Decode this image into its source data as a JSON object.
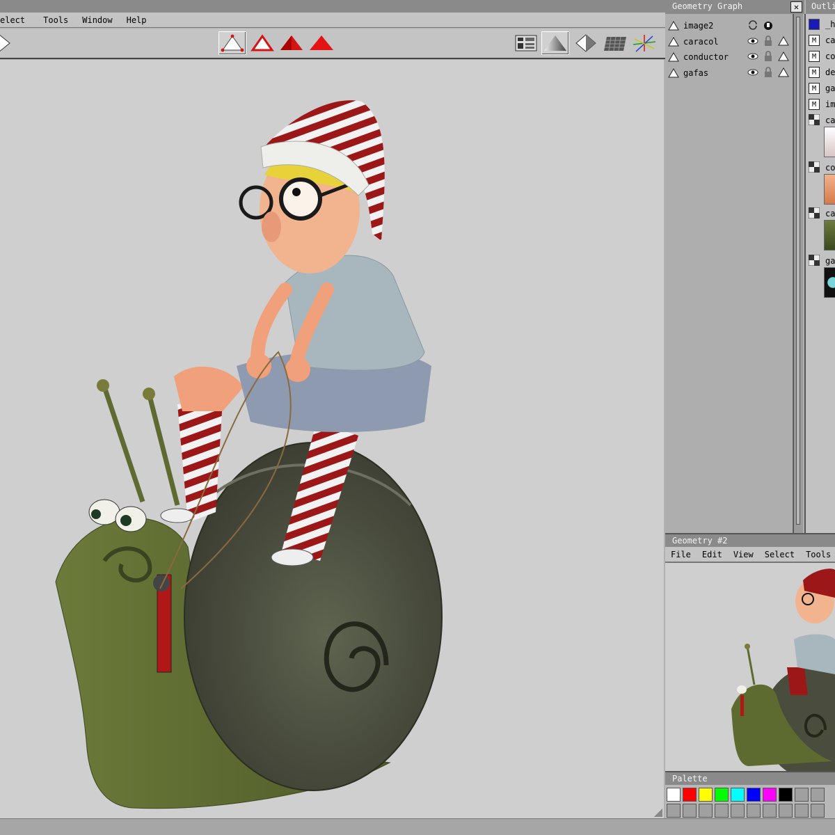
{
  "menu": {
    "items": [
      "elect",
      "Tools",
      "Window",
      "Help"
    ]
  },
  "geometry_graph": {
    "title": "Geometry Graph",
    "items": [
      {
        "label": "image2",
        "icons": [
          "loop-icon",
          "lock-icon"
        ]
      },
      {
        "label": "caracol",
        "icons": [
          "eye-icon",
          "lock-icon",
          "triangle-icon"
        ]
      },
      {
        "label": "conductor",
        "icons": [
          "eye-icon",
          "lock-icon",
          "triangle-icon"
        ]
      },
      {
        "label": "gafas",
        "icons": [
          "eye-icon",
          "lock-icon",
          "triangle-icon"
        ]
      }
    ]
  },
  "outliner": {
    "title": "Outlin",
    "items": [
      "_he",
      "car",
      "cor",
      "def",
      "gaf",
      "ima"
    ],
    "textures": [
      "car",
      "cor",
      "car",
      "gaf"
    ]
  },
  "geometry2": {
    "title": "Geometry #2",
    "menu": [
      "File",
      "Edit",
      "View",
      "Select",
      "Tools"
    ]
  },
  "palette": {
    "title": "Palette",
    "colors": [
      "#ffffff",
      "#ff0000",
      "#ffff00",
      "#00ff00",
      "#00ffff",
      "#0000ff",
      "#ff00ff",
      "#000000",
      "#a0a0a0",
      "#a0a0a0",
      "#a0a0a0"
    ]
  },
  "colors": {
    "accent": "#d41414",
    "panel": "#aeaeae",
    "viewport": "#cfcfcf"
  }
}
